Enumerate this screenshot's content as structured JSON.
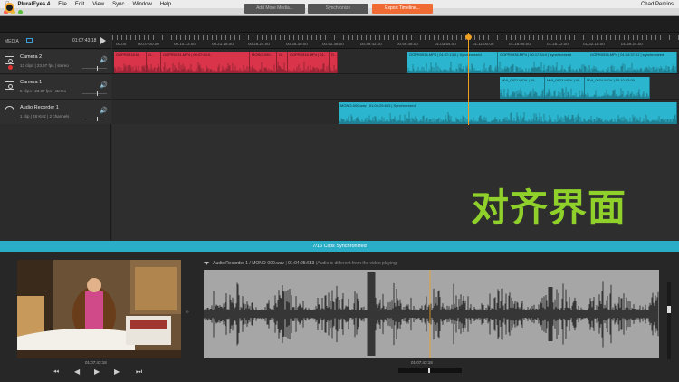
{
  "menubar": {
    "apple": "",
    "app": "PluralEyes 4",
    "items": [
      "File",
      "Edit",
      "View",
      "Sync",
      "Window",
      "Help"
    ],
    "user": "Chad Perkins"
  },
  "window": {
    "title": "PluralEyes 4"
  },
  "toolbar": {
    "add_media": "Add More Media...",
    "synchronize": "Synchronize",
    "export": "Export Timeline..."
  },
  "media": {
    "label": "MEDIA",
    "timecode": "01:07:43:18"
  },
  "tracks": [
    {
      "name": "Camera 2",
      "meta": "12 clips  |  23.97 fps  |  stereo"
    },
    {
      "name": "Camera 1",
      "meta": "5 clips  |  23.97 fps  |  stereo"
    },
    {
      "name": "Audio Recorder 1",
      "meta": "1 clip  |  48 KHz  |  2 channels"
    }
  ],
  "ruler_labels": [
    "00:00",
    "00:07:00:00",
    "00:14:13:00",
    "00:21:18:00",
    "00:28:24:00",
    "00:35:30:00",
    "00:42:36:00",
    "00:49:42:00",
    "00:56:48:00",
    "01:03:54:00",
    "01:11:00:00",
    "01:18:06:00",
    "01:25:12:00",
    "01:32:18:00",
    "01:39:24:00"
  ],
  "clips": {
    "cam2_red": [
      "GOPR0918.M..",
      "G..",
      "GOPR0931.MP4 | 00:07:45:0..",
      "MONO-000..",
      "G..",
      "GOPR0916.MP4 | 01..",
      "G.."
    ],
    "cam2_blue": [
      "GOPR0934.MP4 | 01:07:13:0 | Synchronized",
      "GOPR0936.MP4 | 00:17:34:0 | synchronized",
      "GOPR0936.MP4 | 01:14:37:01 | synchronized"
    ],
    "cam1": [
      "MVI_0822.MOV | 00..",
      "MVI_0823.MOV | 00..",
      "MVI_0824.MOV | 00:10:03:00"
    ],
    "audio": [
      "MONO-000.wav | 01:04:25:653 | Synchronized"
    ]
  },
  "overlay_text": "对齐界面",
  "status": "7/16 Clips Synchronized",
  "preview": {
    "timecode": "01:07:43:18"
  },
  "waveform": {
    "header": "Audio Recorder 1 / MONO-000.wav",
    "header_tc": "01:04:25:653",
    "header_note": "(Audio is different from the video playing)",
    "timecode": "01:07:43:18"
  },
  "colors": {
    "accent_orange": "#f06b33",
    "sync_blue": "#2bb5cf",
    "clip_red": "#d9344a",
    "overlay_green": "#8fd12a"
  }
}
